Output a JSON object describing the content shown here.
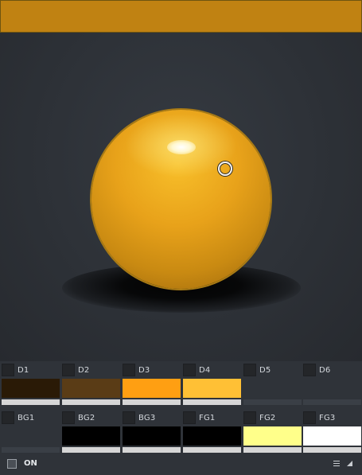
{
  "top_bar": {
    "color": "#c08212"
  },
  "viewport": {
    "object": "sphere",
    "sphere_color": "#e8a21a"
  },
  "swatches": {
    "row1": [
      {
        "label": "D1",
        "color": "#2a1a06",
        "bar": true
      },
      {
        "label": "D2",
        "color": "#5a3c16",
        "bar": true
      },
      {
        "label": "D3",
        "color": "#ff9f12",
        "bar": true
      },
      {
        "label": "D4",
        "color": "#ffc035",
        "bar": true
      },
      {
        "label": "D5",
        "color": "#2f3339",
        "bar": false
      },
      {
        "label": "D6",
        "color": "#2f3339",
        "bar": false
      }
    ],
    "row2": [
      {
        "label": "BG1",
        "color": "#2f3339",
        "bar": false
      },
      {
        "label": "BG2",
        "color": "#000000",
        "bar": true
      },
      {
        "label": "BG3",
        "color": "#000000",
        "bar": true
      },
      {
        "label": "FG1",
        "color": "#000000",
        "bar": true
      },
      {
        "label": "FG2",
        "color": "#ffff8a",
        "bar": true
      },
      {
        "label": "FG3",
        "color": "#ffffff",
        "bar": true
      }
    ]
  },
  "footer": {
    "on_label": "ON"
  },
  "icons": {
    "menu": "menu-lines-icon",
    "resize": "resize-corner-icon"
  }
}
